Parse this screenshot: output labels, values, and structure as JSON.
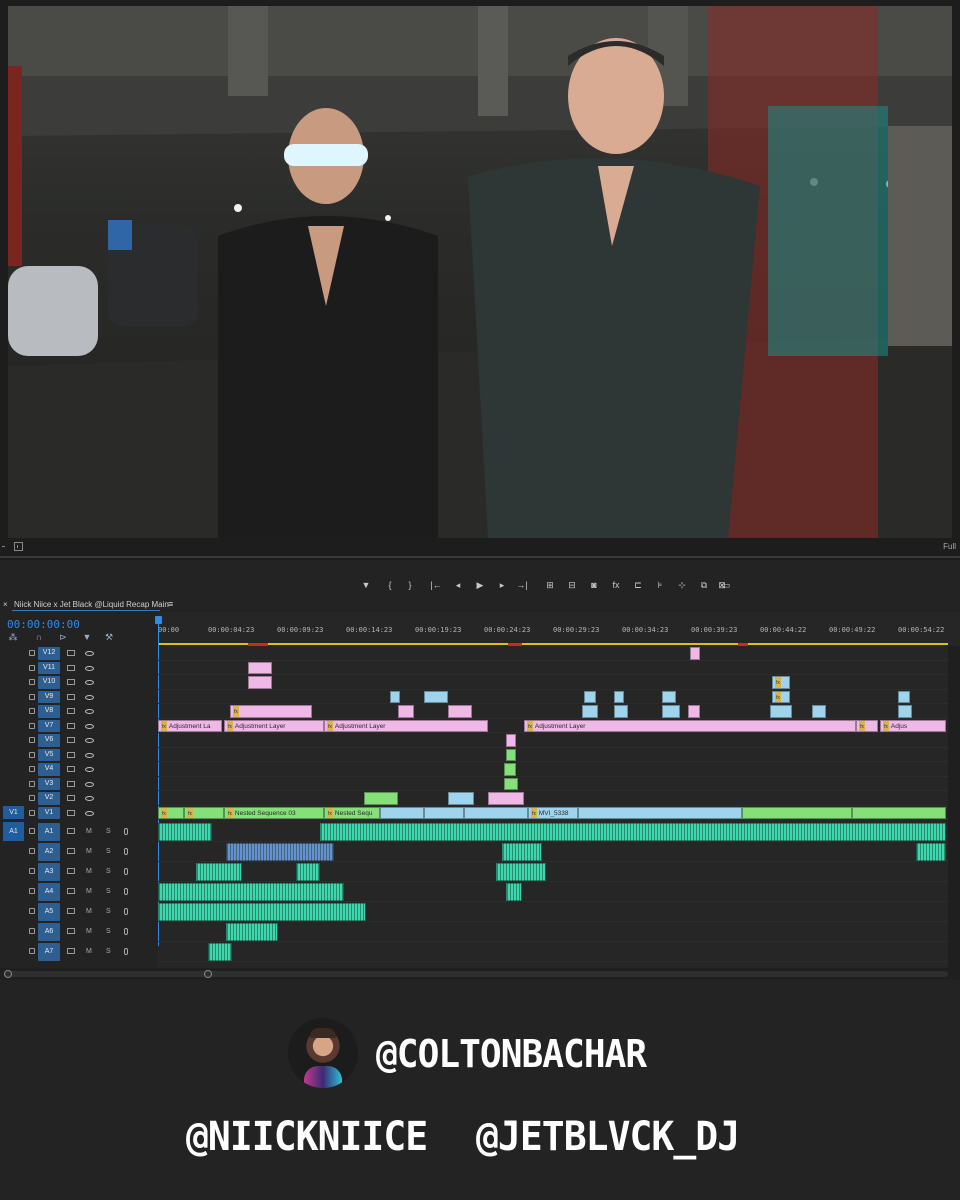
{
  "monitor": {
    "zoom": "Full"
  },
  "transport": {
    "buttons": [
      {
        "name": "add-marker-icon",
        "glyph": "▼"
      },
      {
        "name": "mark-in-icon",
        "glyph": "{"
      },
      {
        "name": "mark-out-icon",
        "glyph": "}"
      },
      {
        "name": "go-to-in-icon",
        "glyph": "|←"
      },
      {
        "name": "step-back-icon",
        "glyph": "◂"
      },
      {
        "name": "play-icon",
        "glyph": "▶"
      },
      {
        "name": "step-forward-icon",
        "glyph": "▸"
      },
      {
        "name": "go-to-out-icon",
        "glyph": "→|"
      },
      {
        "name": "lift-icon",
        "glyph": "⊞"
      },
      {
        "name": "extract-icon",
        "glyph": "⊟"
      },
      {
        "name": "export-frame-icon",
        "glyph": "◙"
      },
      {
        "name": "fx-icon",
        "glyph": "fx"
      },
      {
        "name": "comparison-icon",
        "glyph": "⊏"
      },
      {
        "name": "settings-icon",
        "glyph": "⊧"
      },
      {
        "name": "multicam-icon",
        "glyph": "⊹"
      },
      {
        "name": "proxy-icon",
        "glyph": "⧉"
      },
      {
        "name": "vr-icon",
        "glyph": "⊠"
      },
      {
        "name": "safe-margins-icon",
        "glyph": "▭"
      }
    ]
  },
  "sequence": {
    "name": "Niick Niice x Jet Black @Liquid Recap Main",
    "menu_glyph": "≡",
    "close_glyph": "×",
    "timecode": "00:00:00:00"
  },
  "ruler": {
    "labels": [
      "00:00",
      "00:00:04:23",
      "00:00:09:23",
      "00:00:14:23",
      "00:00:19:23",
      "00:00:24:23",
      "00:00:29:23",
      "00:00:34:23",
      "00:00:39:23",
      "00:00:44:22",
      "00:00:49:22",
      "00:00:54:22"
    ]
  },
  "tracks": {
    "video": [
      {
        "name": "V12",
        "source": ""
      },
      {
        "name": "V11",
        "source": ""
      },
      {
        "name": "V10",
        "source": ""
      },
      {
        "name": "V9",
        "source": ""
      },
      {
        "name": "V8",
        "source": ""
      },
      {
        "name": "V7",
        "source": ""
      },
      {
        "name": "V6",
        "source": ""
      },
      {
        "name": "V5",
        "source": ""
      },
      {
        "name": "V4",
        "source": ""
      },
      {
        "name": "V3",
        "source": ""
      },
      {
        "name": "V2",
        "source": ""
      },
      {
        "name": "V1",
        "source": "V1"
      }
    ],
    "audio": [
      {
        "name": "A1",
        "source": "A1"
      },
      {
        "name": "A2",
        "source": ""
      },
      {
        "name": "A3",
        "source": ""
      },
      {
        "name": "A4",
        "source": ""
      },
      {
        "name": "A5",
        "source": ""
      },
      {
        "name": "A6",
        "source": ""
      },
      {
        "name": "A7",
        "source": ""
      }
    ],
    "mute_label": "M",
    "solo_label": "S"
  },
  "clip_labels": {
    "adjustment_short": "Adjustment La",
    "adjustment": "Adjustment Layer",
    "adjustment_tail": "Adjus",
    "nested_03": "Nested Sequence 03",
    "nested_short": "Nested Sequ",
    "mvi": "MVI_5338",
    "fx": "fx"
  },
  "colors": {
    "adjustment": "#f0b8e6",
    "video_blue": "#9fd4ec",
    "nested_green": "#86e07a",
    "audio_teal": "#3fd6ae",
    "audio_blue": "#6a8fcf",
    "playhead": "#2d8ceb"
  },
  "credits": {
    "photographer": "@COLTONBACHAR",
    "artist_1": "@NIICKNIICE",
    "artist_2": "@JETBLVCK_DJ"
  }
}
